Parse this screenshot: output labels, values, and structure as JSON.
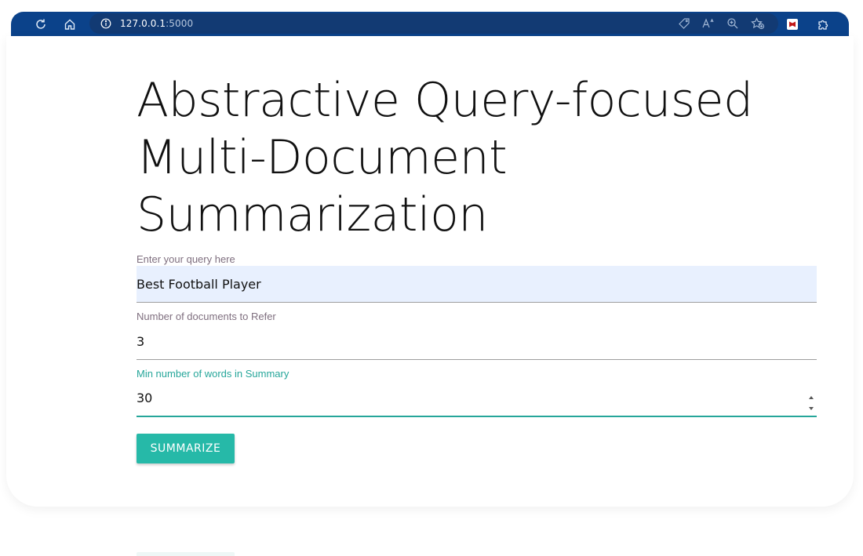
{
  "browser": {
    "url_host": "127.0.0.1",
    "url_port": ":5000",
    "icons": {
      "reload": "refresh-icon",
      "home": "home-icon",
      "site_info": "info-icon",
      "tag": "tag-icon",
      "read_aloud": "read-aloud-icon",
      "zoom": "zoom-icon",
      "favorite": "add-favorite-icon",
      "extension": "mcafee-extension-icon",
      "extensions": "extensions-icon"
    }
  },
  "page": {
    "title": "Abstractive Query-focused Multi-Document Summarization",
    "fields": [
      {
        "label": "Enter your query here",
        "value": "Best Football Player",
        "type": "text"
      },
      {
        "label": "Number of documents to Refer",
        "value": "3",
        "type": "text"
      },
      {
        "label": "Min number of words in Summary",
        "value": "30",
        "type": "number"
      }
    ],
    "submit_label": "SUMMARIZE"
  },
  "colors": {
    "toolbar": "#0b428a",
    "accent": "#26a69a",
    "button": "#26b9a8",
    "autofill": "#e8f0fe"
  }
}
